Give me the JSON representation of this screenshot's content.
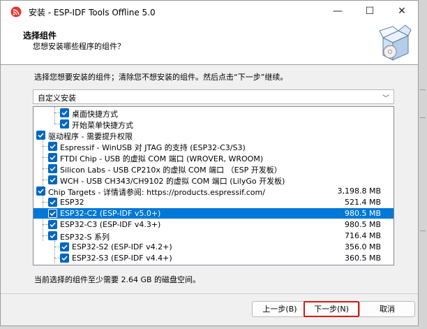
{
  "window": {
    "title": "安装 - ESP-IDF Tools Offline 5.0"
  },
  "title_controls": {
    "minimize": "—",
    "maximize": "☐",
    "close": "✕"
  },
  "header": {
    "title": "选择组件",
    "subtitle": "您想安装哪些程序的组件？",
    "icon": "installer-box-icon"
  },
  "instructions": "选择您想要安装的组件；清除您不想安装的组件。然后点击“下一步”继续。",
  "install_type": {
    "selected": "自定义安装"
  },
  "components": [
    {
      "label": "桌面快捷方式",
      "size": "",
      "checked": true,
      "selected": false
    },
    {
      "label": "开始菜单快捷方式",
      "size": "",
      "checked": true,
      "selected": false
    },
    {
      "label": "驱动程序 - 需要提升权限",
      "size": "",
      "checked": true,
      "selected": false
    },
    {
      "label": "Espressif - WinUSB 对 JTAG 的支持 (ESP32-C3/S3)",
      "size": "",
      "checked": true,
      "selected": false
    },
    {
      "label": "FTDI Chip - USB 的虚拟 COM 端口 (WROVER, WROOM)",
      "size": "",
      "checked": true,
      "selected": false
    },
    {
      "label": "Silicon Labs - USB CP210x 的虚拟 COM 端口 （ESP 开发板）",
      "size": "",
      "checked": true,
      "selected": false
    },
    {
      "label": "WCH - USB CH343/CH9102 的虚拟 COM 端口 (LilyGo 开发板)",
      "size": "",
      "checked": true,
      "selected": false
    },
    {
      "label": "Chip Targets - 详情请参阅: https://products.espressif.com/",
      "size": "3,198.8 MB",
      "checked": true,
      "selected": false
    },
    {
      "label": "ESP32",
      "size": "521.4 MB",
      "checked": true,
      "selected": false
    },
    {
      "label": "ESP32-C2 (ESP-IDF v5.0+)",
      "size": "980.5 MB",
      "checked": true,
      "selected": true
    },
    {
      "label": "ESP32-C3 (ESP-IDF v4.3+)",
      "size": "980.5 MB",
      "checked": true,
      "selected": false
    },
    {
      "label": "ESP32-S 系列",
      "size": "716.4 MB",
      "checked": true,
      "selected": false
    },
    {
      "label": "ESP32-S2 (ESP-IDF v4.2+)",
      "size": "356.0 MB",
      "checked": true,
      "selected": false
    },
    {
      "label": "ESP32-S3 (ESP-IDF v4.4+)",
      "size": "360.5 MB",
      "checked": true,
      "selected": false
    }
  ],
  "disk_space": "当前选择的组件至少需要 2.64 GB 的磁盘空间。",
  "buttons": {
    "back": "上一步(B)",
    "next": "下一步(N)",
    "cancel": "取消"
  },
  "colors": {
    "accent": "#0078d7",
    "checkbox": "#0067c0",
    "highlight_border": "#d11a1a"
  }
}
